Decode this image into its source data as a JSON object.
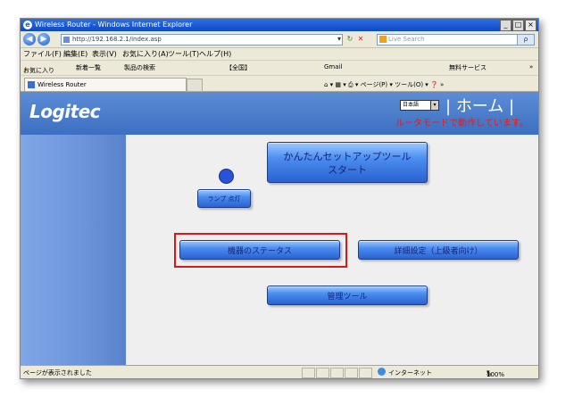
{
  "window": {
    "title": "Wireless Router - Windows Internet Explorer",
    "min": "_",
    "max": "□",
    "close": "×"
  },
  "address": {
    "url": "http://192.168.2.1/index.asp",
    "search_placeholder": "Live Search",
    "go": "ρ"
  },
  "menu": [
    "ファイル(F)",
    "編集(E)",
    "表示(V)",
    "お気に入り(A)",
    "ツール(T)",
    "ヘルプ(H)"
  ],
  "favorites": [
    "お気に入り",
    "新着一覧",
    "製品の検索",
    "【全国】",
    "Gmail",
    "無料サービス"
  ],
  "tab": {
    "label": "Wireless Router"
  },
  "commandbar": "ページ(P) ▾ ツール(O) ▾",
  "header": {
    "logo": "Logitec",
    "language": "日本語",
    "home": "ホーム",
    "mode_text": "ルータモードで動作しています。"
  },
  "buttons": {
    "setup_line1": "かんたんセットアップツール",
    "setup_line2": "スタート",
    "lamp": "ランプ 点灯",
    "status": "機器のステータス",
    "advanced": "詳細設定（上級者向け）",
    "admin": "管理ツール"
  },
  "statusbar": {
    "left": "ページが表示されました",
    "zone": "インターネット",
    "zoom": "100%"
  }
}
